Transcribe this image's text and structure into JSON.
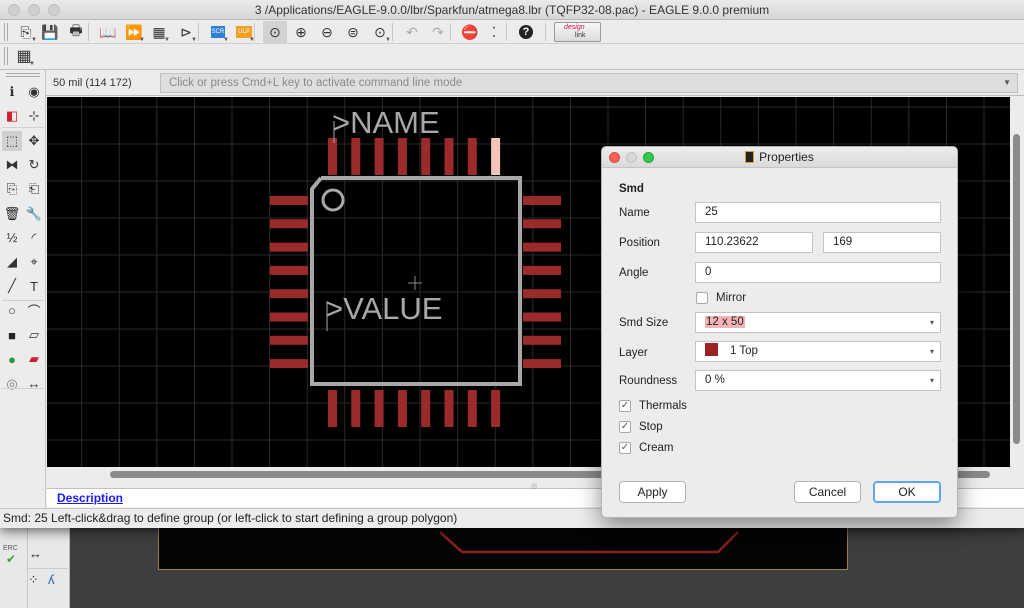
{
  "window": {
    "title": "3 /Applications/EAGLE-9.0.0/lbr/Sparkfun/atmega8.lbr (TQFP32-08.pac) - EAGLE 9.0.0 premium"
  },
  "toolbar": {
    "items": [
      {
        "name": "open-icon",
        "glyph": "⎘"
      },
      {
        "name": "save-icon",
        "glyph": "💾"
      },
      {
        "name": "print-icon",
        "glyph": "🖶"
      },
      {
        "name": "library-icon",
        "glyph": "📖"
      },
      {
        "name": "forward-icon",
        "glyph": "⏩"
      },
      {
        "name": "package-icon",
        "glyph": "▦"
      },
      {
        "name": "symbol-icon",
        "glyph": "⊳"
      },
      {
        "name": "script-icon",
        "glyph": "SCR"
      },
      {
        "name": "ulp-icon",
        "glyph": "ULP"
      },
      {
        "name": "zoom-fit-icon",
        "glyph": "⊙"
      },
      {
        "name": "zoom-in-icon",
        "glyph": "⊕"
      },
      {
        "name": "zoom-out-icon",
        "glyph": "⊖"
      },
      {
        "name": "zoom-redraw-icon",
        "glyph": "⊜"
      },
      {
        "name": "zoom-select-icon",
        "glyph": "⊙"
      },
      {
        "name": "undo-icon",
        "glyph": "↶"
      },
      {
        "name": "redo-icon",
        "glyph": "↷"
      },
      {
        "name": "stop-icon",
        "glyph": "⛔"
      },
      {
        "name": "go-icon",
        "glyph": "⁚"
      },
      {
        "name": "help-icon",
        "glyph": "?"
      }
    ],
    "designlink_label_top": "design",
    "designlink_label_bottom": "link",
    "grid_icon": "▦"
  },
  "command": {
    "coordinate": "50 mil (114 172)",
    "placeholder": "Click or press Cmd+L key to activate command line mode"
  },
  "left_tools": [
    {
      "name": "info-icon",
      "glyph": "ℹ"
    },
    {
      "name": "show-icon",
      "glyph": "◉"
    },
    {
      "name": "layers-icon",
      "glyph": "◧"
    },
    {
      "name": "mark-icon",
      "glyph": "⊹"
    },
    {
      "name": "group-select-icon",
      "glyph": "⬚"
    },
    {
      "name": "move-icon",
      "glyph": "✥"
    },
    {
      "name": "mirror-icon",
      "glyph": "⧓"
    },
    {
      "name": "rotate-icon",
      "glyph": "↻"
    },
    {
      "name": "copy-icon",
      "glyph": "⎘"
    },
    {
      "name": "paste-icon",
      "glyph": "⎗"
    },
    {
      "name": "delete-icon",
      "glyph": "🗑"
    },
    {
      "name": "change-icon",
      "glyph": "🔧"
    },
    {
      "name": "name-value-icon",
      "glyph": "½"
    },
    {
      "name": "miter-icon",
      "glyph": "◜"
    },
    {
      "name": "split-icon",
      "glyph": "◢"
    },
    {
      "name": "optimize-icon",
      "glyph": "⌖"
    },
    {
      "name": "wire-icon",
      "glyph": "╱"
    },
    {
      "name": "text-icon",
      "glyph": "T"
    },
    {
      "name": "circle-icon",
      "glyph": "○"
    },
    {
      "name": "arc-icon",
      "glyph": "⌒"
    },
    {
      "name": "rectangle-icon",
      "glyph": "■"
    },
    {
      "name": "polygon-icon",
      "glyph": "▱"
    },
    {
      "name": "pad-icon",
      "glyph": "●"
    },
    {
      "name": "smd-icon",
      "glyph": "▰"
    },
    {
      "name": "via-icon",
      "glyph": "◎"
    },
    {
      "name": "dimension-icon",
      "glyph": "↔"
    }
  ],
  "canvas": {
    "name_label": ">NAME",
    "value_label": ">VALUE",
    "pads_per_side": 8,
    "selected_pad": "25",
    "pad_color": "#9b2a2a",
    "selected_pad_color": "#f4c4b8",
    "outline_color": "#a8a8a8"
  },
  "description_link": "Description",
  "status_text": "Smd: 25 Left-click&drag to define group (or left-click to start defining a group polygon)",
  "bg_window": {
    "erc_label": "ERC"
  },
  "properties_dialog": {
    "title": "Properties",
    "section": "Smd",
    "name_label": "Name",
    "name_value": "25",
    "position_label": "Position",
    "position_x": "110.23622",
    "position_y": "169",
    "angle_label": "Angle",
    "angle_value": "0",
    "mirror_label": "Mirror",
    "mirror_checked": false,
    "smd_size_label": "Smd Size",
    "smd_size_value": "12 x 50",
    "layer_label": "Layer",
    "layer_value": "1 Top",
    "layer_color": "#9b2222",
    "roundness_label": "Roundness",
    "roundness_value": "0 %",
    "thermals_label": "Thermals",
    "thermals_checked": true,
    "stop_label": "Stop",
    "stop_checked": true,
    "cream_label": "Cream",
    "cream_checked": true,
    "apply_label": "Apply",
    "cancel_label": "Cancel",
    "ok_label": "OK",
    "checkmark": "✓",
    "dropdown_arrow": "▾"
  }
}
